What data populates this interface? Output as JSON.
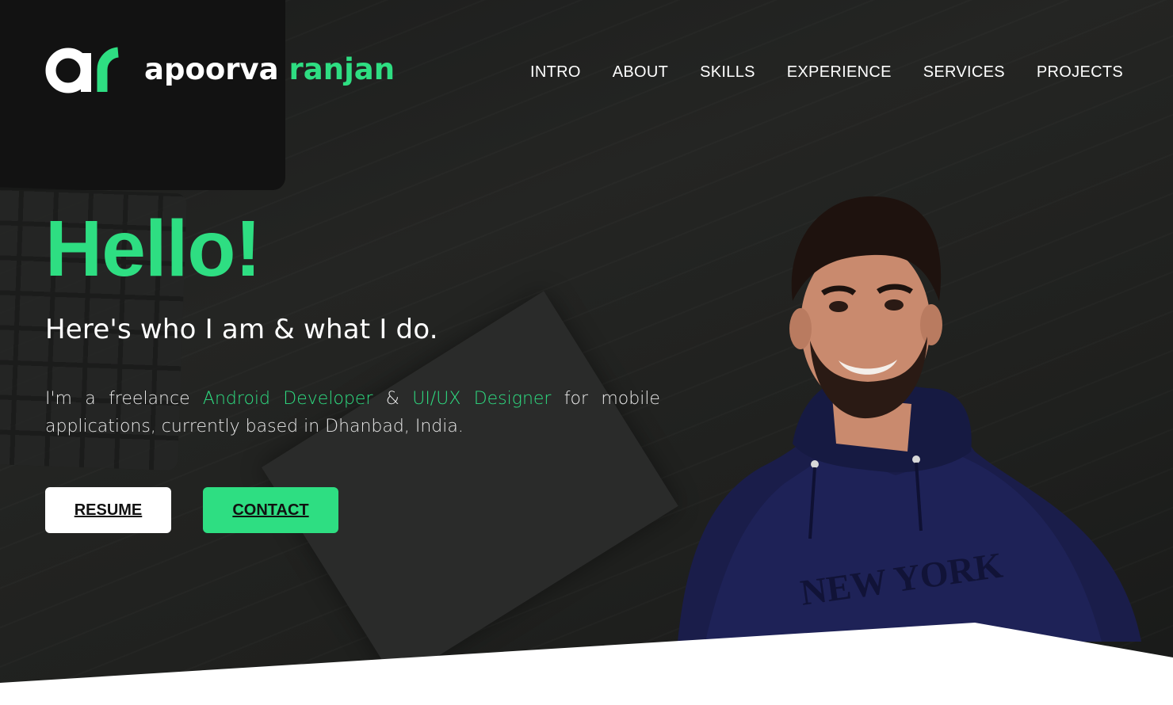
{
  "brand": {
    "logo_mark": "ar",
    "first_name": "apoorva",
    "last_name": "ranjan"
  },
  "nav": {
    "items": [
      {
        "label": "INTRO"
      },
      {
        "label": "ABOUT"
      },
      {
        "label": "SKILLS"
      },
      {
        "label": "EXPERIENCE"
      },
      {
        "label": "SERVICES"
      },
      {
        "label": "PROJECTS"
      }
    ]
  },
  "hero": {
    "greeting": "Hello!",
    "subtitle": "Here's who I am & what I do.",
    "intro": {
      "part1": "I'm a freelance ",
      "role1": "Android Developer",
      "part2": " & ",
      "role2": "UI/UX Designer",
      "part3": " for mobile applications, currently based in Dhanbad, India."
    },
    "buttons": {
      "resume": "RESUME",
      "contact": "CONTACT"
    }
  },
  "colors": {
    "accent": "#2ede82",
    "background": "#1f201e",
    "text": "#ffffff"
  },
  "icons": {
    "logo": "ar-monogram-logo",
    "portrait": "profile-photo"
  }
}
